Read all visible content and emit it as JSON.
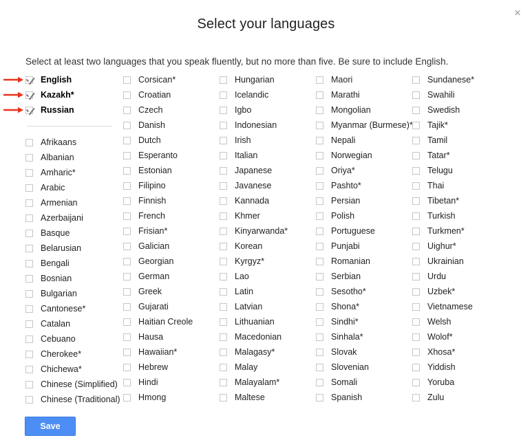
{
  "dialog": {
    "title": "Select your languages",
    "close_label": "×",
    "instruction": "Select at least two languages that you speak fluently, but no more than five. Be sure to include English.",
    "save_label": "Save"
  },
  "selected_languages": [
    {
      "label": "English",
      "checked": true
    },
    {
      "label": "Kazakh*",
      "checked": true
    },
    {
      "label": "Russian",
      "checked": true
    }
  ],
  "columns": [
    {
      "items": [
        "Afrikaans",
        "Albanian",
        "Amharic*",
        "Arabic",
        "Armenian",
        "Azerbaijani",
        "Basque",
        "Belarusian",
        "Bengali",
        "Bosnian",
        "Bulgarian",
        "Cantonese*",
        "Catalan",
        "Cebuano",
        "Cherokee*",
        "Chichewa*",
        "Chinese (Simplified)",
        "Chinese (Traditional)"
      ]
    },
    {
      "items": [
        "Corsican*",
        "Croatian",
        "Czech",
        "Danish",
        "Dutch",
        "Esperanto",
        "Estonian",
        "Filipino",
        "Finnish",
        "French",
        "Frisian*",
        "Galician",
        "Georgian",
        "German",
        "Greek",
        "Gujarati",
        "Haitian Creole",
        "Hausa",
        "Hawaiian*",
        "Hebrew",
        "Hindi",
        "Hmong"
      ]
    },
    {
      "items": [
        "Hungarian",
        "Icelandic",
        "Igbo",
        "Indonesian",
        "Irish",
        "Italian",
        "Japanese",
        "Javanese",
        "Kannada",
        "Khmer",
        "Kinyarwanda*",
        "Korean",
        "Kyrgyz*",
        "Lao",
        "Latin",
        "Latvian",
        "Lithuanian",
        "Macedonian",
        "Malagasy*",
        "Malay",
        "Malayalam*",
        "Maltese"
      ]
    },
    {
      "items": [
        "Maori",
        "Marathi",
        "Mongolian",
        "Myanmar (Burmese)*",
        "Nepali",
        "Norwegian",
        "Oriya*",
        "Pashto*",
        "Persian",
        "Polish",
        "Portuguese",
        "Punjabi",
        "Romanian",
        "Serbian",
        "Sesotho*",
        "Shona*",
        "Sindhi*",
        "Sinhala*",
        "Slovak",
        "Slovenian",
        "Somali",
        "Spanish"
      ]
    },
    {
      "items": [
        "Sundanese*",
        "Swahili",
        "Swedish",
        "Tajik*",
        "Tamil",
        "Tatar*",
        "Telugu",
        "Thai",
        "Tibetan*",
        "Turkish",
        "Turkmen*",
        "Uighur*",
        "Ukrainian",
        "Urdu",
        "Uzbek*",
        "Vietnamese",
        "Welsh",
        "Wolof*",
        "Xhosa*",
        "Yiddish",
        "Yoruba",
        "Zulu"
      ]
    }
  ],
  "annotations": {
    "arrow_color": "#e8331c",
    "arrow_targets": [
      "English",
      "Kazakh*",
      "Russian"
    ]
  }
}
